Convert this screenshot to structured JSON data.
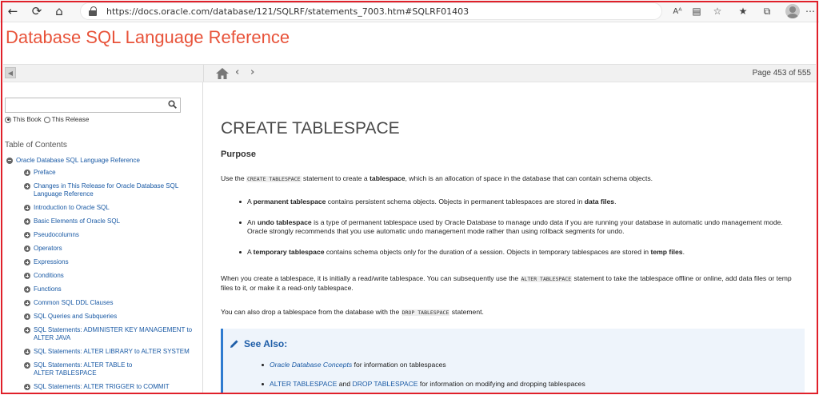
{
  "browser": {
    "url": "https://docs.oracle.com/database/121/SQLRF/statements_7003.htm#SQLRF01403",
    "reader_label": "Aᴬ"
  },
  "site": {
    "title": "Database SQL Language Reference"
  },
  "toolbar": {
    "page_indicator": "Page 453 of 555"
  },
  "sidebar": {
    "search": {
      "value": "",
      "placeholder": ""
    },
    "scope_options": [
      "This Book",
      "This Release"
    ],
    "scope_selected": "This Book",
    "toc_heading": "Table of Contents",
    "toc_root": "Oracle Database SQL Language Reference",
    "toc_items": [
      {
        "label": "Preface"
      },
      {
        "label": "Changes in This Release for Oracle Database SQL Language Reference"
      },
      {
        "label": "Introduction to Oracle SQL"
      },
      {
        "label": "Basic Elements of Oracle SQL"
      },
      {
        "label": "Pseudocolumns"
      },
      {
        "label": "Operators"
      },
      {
        "label": "Expressions"
      },
      {
        "label": "Conditions"
      },
      {
        "label": "Functions"
      },
      {
        "label": "Common SQL DDL Clauses"
      },
      {
        "label": "SQL Queries and Subqueries"
      },
      {
        "label": "SQL Statements: ADMINISTER KEY MANAGEMENT to ALTER JAVA"
      },
      {
        "label": "SQL Statements: ALTER LIBRARY to ALTER SYSTEM"
      },
      {
        "label": "SQL Statements: ALTER TABLE to ALTER TABLESPACE"
      },
      {
        "label": "SQL Statements: ALTER TRIGGER to COMMIT"
      }
    ]
  },
  "content": {
    "title": "CREATE TABLESPACE",
    "purpose_heading": "Purpose",
    "intro": {
      "t1": "Use the ",
      "code1": "CREATE TABLESPACE",
      "t2": " statement to create a ",
      "bold1": "tablespace",
      "t3": ", which is an allocation of space in the database that can contain schema objects."
    },
    "bullet1": {
      "t1": "A ",
      "bold1": "permanent tablespace",
      "t2": " contains persistent schema objects. Objects in permanent tablespaces are stored in ",
      "bold2": "data files",
      "t3": "."
    },
    "bullet2": {
      "t1": "An ",
      "bold1": "undo tablespace",
      "t2": " is a type of permanent tablespace used by Oracle Database to manage undo data if you are running your database in automatic undo management mode. Oracle strongly recommends that you use automatic undo management mode rather than using rollback segments for undo."
    },
    "bullet3": {
      "t1": "A ",
      "bold1": "temporary tablespace",
      "t2": " contains schema objects only for the duration of a session. Objects in temporary tablespaces are stored in ",
      "bold2": "temp files",
      "t3": "."
    },
    "para2": {
      "t1": "When you create a tablespace, it is initially a read/write tablespace. You can subsequently use the ",
      "code1": "ALTER TABLESPACE",
      "t2": " statement to take the tablespace offline or online, add data files or temp files to it, or make it a read-only tablespace."
    },
    "para3": {
      "t1": "You can also drop a tablespace from the database with the ",
      "code1": "DROP TABLESPACE",
      "t2": " statement."
    },
    "see_also": {
      "title": "See Also:",
      "item1_link": "Oracle Database Concepts",
      "item1_text": " for information on tablespaces",
      "item2_link1": "ALTER TABLESPACE",
      "item2_and": " and ",
      "item2_link2": "DROP TABLESPACE",
      "item2_text": " for information on modifying and dropping tablespaces"
    }
  },
  "colors": {
    "title": "#e8533a",
    "link": "#1a5aa5",
    "highlight_frame": "#e0202a",
    "see_also_bg": "#eef4fb"
  }
}
